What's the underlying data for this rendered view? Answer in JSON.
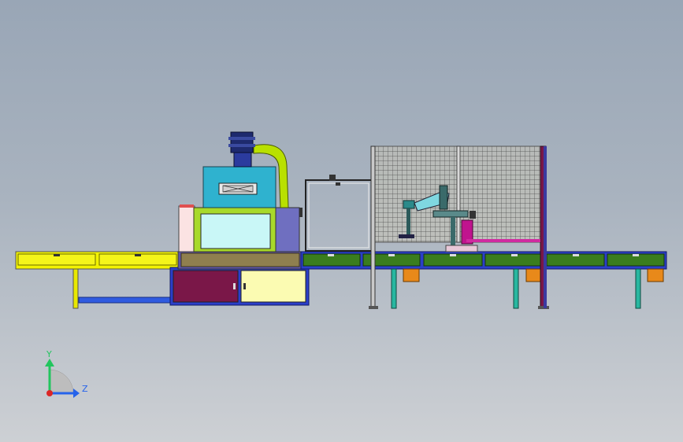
{
  "viewport": {
    "background_top": "#99a6b6",
    "background_bottom": "#cdd0d4"
  },
  "triad": {
    "y_label": "Y",
    "z_label": "Z",
    "y_color": "#22c55e",
    "z_color": "#2563eb",
    "x_color": "#dc2626"
  },
  "colors": {
    "rail_yellow": "#f2f200",
    "rail_green": "#3a7d1e",
    "frame_blue": "#2b3fc9",
    "cabinet_maroon": "#7a1748",
    "cabinet_cream": "#fbfbb2",
    "hood_cyan": "#2fb2cf",
    "chamber_lime": "#a8d92a",
    "duct_lime": "#b9e000",
    "motor_navy": "#1e2a6e",
    "side_panel_purple": "#6f6fc0",
    "belt_olive": "#8f7f4f",
    "guard_mesh": "#5a5a5a",
    "part_magenta": "#c0148e",
    "foot_orange": "#e8891a",
    "leg_teal": "#28b7a0"
  }
}
